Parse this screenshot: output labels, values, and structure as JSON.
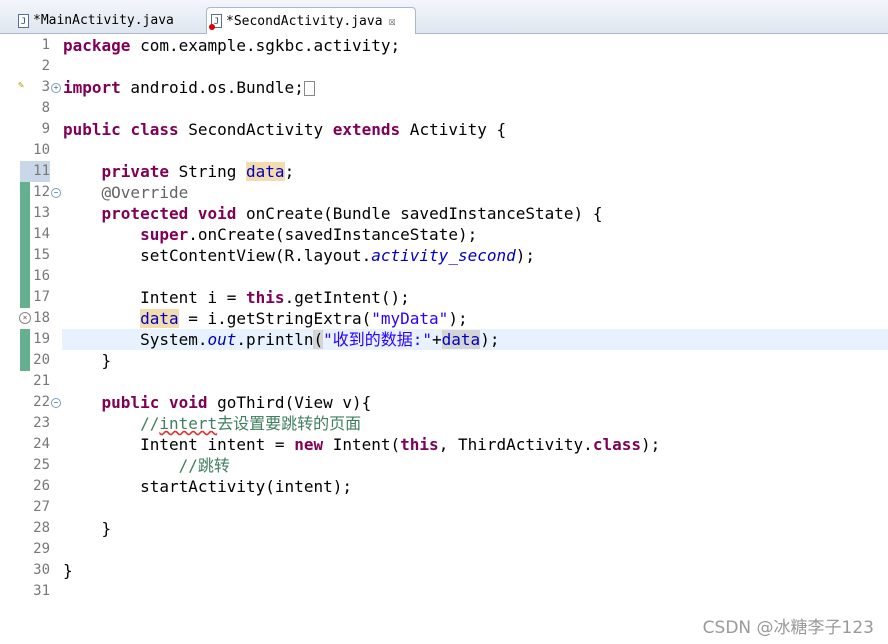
{
  "tabs": [
    {
      "label": "*MainActivity.java",
      "icon": "java-file-icon"
    },
    {
      "label": "*SecondActivity.java",
      "icon": "java-file-error-icon",
      "close": "☒"
    }
  ],
  "lines": [
    {
      "num": "1"
    },
    {
      "num": "2"
    },
    {
      "num": "3"
    },
    {
      "num": "8"
    },
    {
      "num": "9"
    },
    {
      "num": "10"
    },
    {
      "num": "11"
    },
    {
      "num": "12"
    },
    {
      "num": "13"
    },
    {
      "num": "14"
    },
    {
      "num": "15"
    },
    {
      "num": "16"
    },
    {
      "num": "17"
    },
    {
      "num": "18"
    },
    {
      "num": "19"
    },
    {
      "num": "20"
    },
    {
      "num": "21"
    },
    {
      "num": "22"
    },
    {
      "num": "23"
    },
    {
      "num": "24"
    },
    {
      "num": "25"
    },
    {
      "num": "26"
    },
    {
      "num": "27"
    },
    {
      "num": "28"
    },
    {
      "num": "29"
    },
    {
      "num": "30"
    },
    {
      "num": "31"
    }
  ],
  "code": {
    "l1_kw": "package",
    "l1_rest": " com.example.sgkbc.activity;",
    "l3_kw": "import",
    "l3_rest": " android.os.Bundle;",
    "l9_kw1": "public",
    "l9_kw2": "class",
    "l9_mid": " SecondActivity ",
    "l9_kw3": "extends",
    "l9_rest": " Activity {",
    "l11_kw": "private",
    "l11_mid": " String ",
    "l11_fld": "data",
    "l11_end": ";",
    "l12_ann": "@Override",
    "l13_kw1": "protected",
    "l13_kw2": "void",
    "l13_rest": " onCreate(Bundle savedInstanceState) {",
    "l14_kw": "super",
    "l14_rest": ".onCreate(savedInstanceState);",
    "l15_a": "setContentView(R.layout.",
    "l15_sfld": "activity_second",
    "l15_b": ");",
    "l17_a": "Intent i = ",
    "l17_kw": "this",
    "l17_b": ".getIntent();",
    "l18_fld": "data",
    "l18_a": " = i.getStringExtra(",
    "l18_str": "\"myData\"",
    "l18_b": ");",
    "l19_a": "System.",
    "l19_sfld": "out",
    "l19_b": ".println",
    "l19_p": "(",
    "l19_str": "\"收到的数据:\"",
    "l19_c": "+",
    "l19_fld": "data",
    "l19_d": ");",
    "l20": "}",
    "l22_kw1": "public",
    "l22_kw2": "void",
    "l22_rest": " goThird(View v){",
    "l23_a": "//",
    "l23_sq": "intert",
    "l23_b": "去设置要跳转的页面",
    "l24_a": "Intent intent = ",
    "l24_kw1": "new",
    "l24_b": " Intent(",
    "l24_kw2": "this",
    "l24_c": ", ThirdActivity.",
    "l24_kw3": "class",
    "l24_d": ");",
    "l25": "//跳转",
    "l26": "startActivity(intent);",
    "l28": "}",
    "l30": "}"
  },
  "watermark": "CSDN @冰糖李子123"
}
